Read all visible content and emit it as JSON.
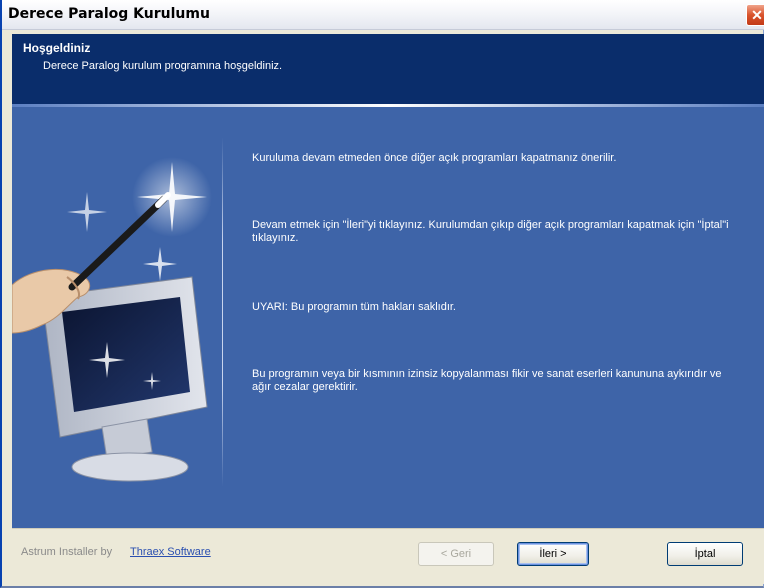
{
  "window": {
    "title": "Derece Paralog Kurulumu",
    "close_icon": "close-icon"
  },
  "header": {
    "title": "Hoşgeldiniz",
    "subtitle": "Derece Paralog kurulum programına hoşgeldiniz."
  },
  "body": {
    "paragraphs": [
      "Kuruluma devam etmeden önce diğer açık programları kapatmanız önerilir.",
      "Devam etmek için \"İleri\"yi tıklayınız. Kurulumdan çıkıp diğer açık programları kapatmak için \"İptal\"i tıklayınız.",
      "UYARI: Bu programın tüm hakları saklıdır.",
      "Bu programın veya bir kısmının izinsiz kopyalanması fikir ve sanat eserleri kanununa aykırıdır ve ağır cezalar gerektirir."
    ],
    "artwork": "magic-wand-monitor-illustration"
  },
  "footer": {
    "brand_text": "Astrum Installer by",
    "brand_link": "Thraex Software",
    "back_label": "< Geri",
    "next_label": "İleri >",
    "cancel_label": "İptal"
  },
  "colors": {
    "header_bg": "#0a2d6b",
    "content_bg": "#3e64a8",
    "footer_bg": "#ece9d8",
    "close_red": "#d9532c"
  }
}
